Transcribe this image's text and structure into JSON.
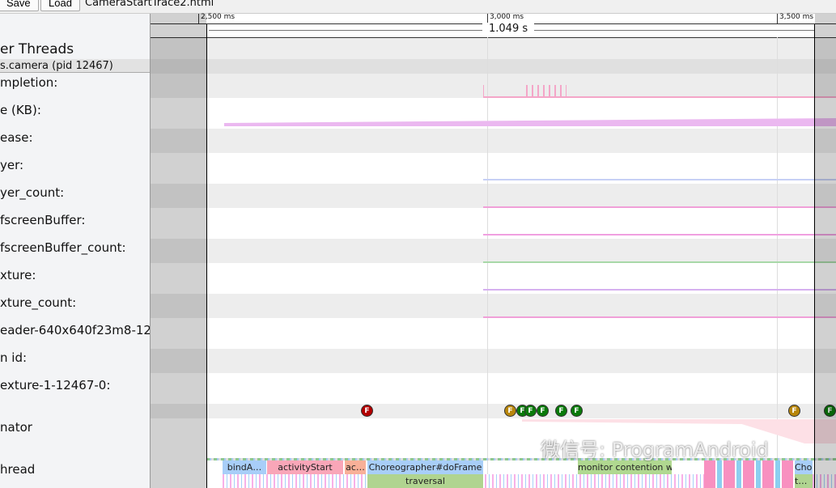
{
  "toolbar": {
    "save": "Save",
    "load": "Load",
    "filename": "CameraStartTrace2.html"
  },
  "ruler": {
    "ticks": [
      "2,500 ms",
      "3,000 ms",
      "3,500 ms"
    ],
    "selection_duration": "1.049 s"
  },
  "sidebar": {
    "group": "er Threads",
    "process": "s.camera (pid 12467)",
    "tracks": [
      "mpletion:",
      "e (KB):",
      "ease:",
      "yer:",
      "yer_count:",
      "fscreenBuffer:",
      "fscreenBuffer_count:",
      "xture:",
      "xture_count:",
      "eader-640x640f23m8-12",
      "n id:",
      "exture-1-12467-0:",
      "nator",
      "hread"
    ]
  },
  "frames": [
    {
      "label": "F",
      "color": "#b30000"
    },
    {
      "label": "F",
      "color": "#b8860b"
    },
    {
      "label": "F",
      "color": "#0a7a0a"
    },
    {
      "label": "F",
      "color": "#0a7a0a"
    },
    {
      "label": "F",
      "color": "#0a7a0a"
    },
    {
      "label": "F",
      "color": "#0a7a0a"
    },
    {
      "label": "F",
      "color": "#0a7a0a"
    },
    {
      "label": "F",
      "color": "#0a7a0a"
    },
    {
      "label": "F",
      "color": "#b8860b"
    },
    {
      "label": "F",
      "color": "#0a7a0a"
    }
  ],
  "slices": [
    "bindA…",
    "activityStart",
    "ac…",
    "Choreographer#doFrame",
    "traversal",
    "monitor contention wi…",
    "Cho",
    "t…"
  ],
  "watermark": "微信号: ProgramAndroid"
}
